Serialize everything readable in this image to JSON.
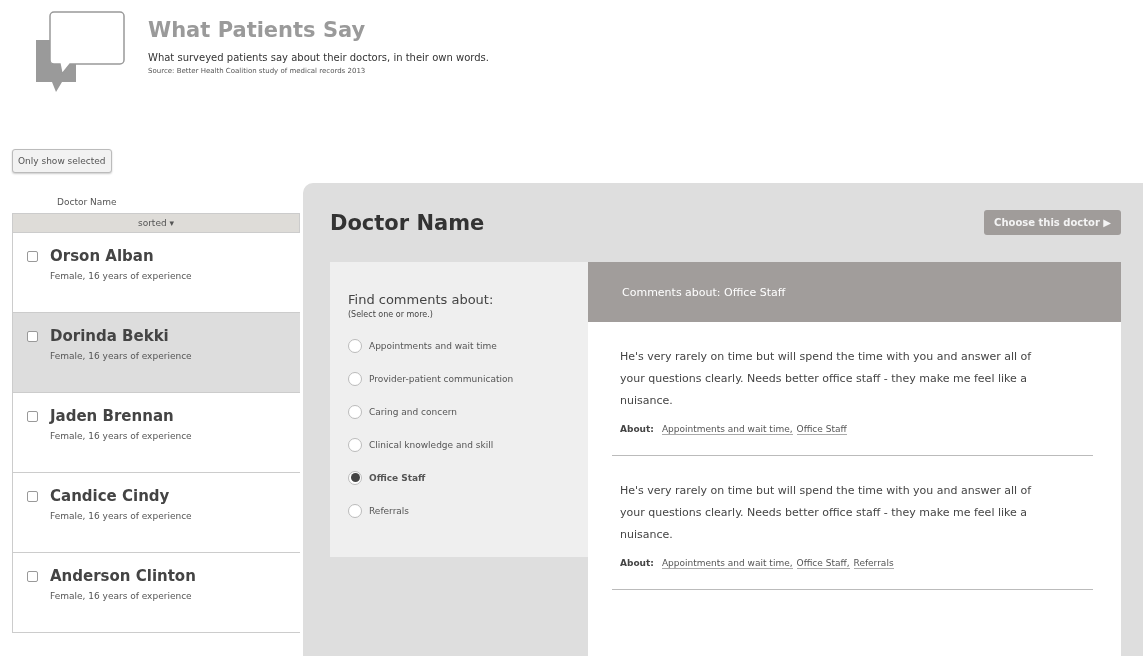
{
  "header": {
    "title": "What Patients Say",
    "subtitle": "What surveyed patients say about their doctors, in their own words.",
    "source": "Source: Better Health Coalition study of medical records 2013"
  },
  "filter_button": "Only show selected",
  "doctor_list": {
    "column": "Doctor Name",
    "sort_label": "sorted ▾",
    "doctors": [
      {
        "name": "Orson Alban",
        "details": "Female, 16 years of experience",
        "checked": false,
        "selected": false
      },
      {
        "name": "Dorinda Bekki",
        "details": "Female, 16 years of experience",
        "checked": false,
        "selected": true
      },
      {
        "name": "Jaden Brennan",
        "details": "Female, 16 years of experience",
        "checked": false,
        "selected": false
      },
      {
        "name": "Candice Cindy",
        "details": "Female, 16 years of experience",
        "checked": false,
        "selected": false
      },
      {
        "name": "Anderson Clinton",
        "details": "Female, 16 years of experience",
        "checked": false,
        "selected": false
      }
    ]
  },
  "detail": {
    "title": "Doctor Name",
    "choose_button": "Choose this doctor ▶",
    "filter": {
      "heading": "Find comments about:",
      "hint": "(Select one or more.)",
      "options": [
        {
          "label": "Appointments and wait time",
          "selected": false
        },
        {
          "label": "Provider-patient communication",
          "selected": false
        },
        {
          "label": "Caring and concern",
          "selected": false
        },
        {
          "label": "Clinical knowledge and skill",
          "selected": false
        },
        {
          "label": "Office Staff",
          "selected": true
        },
        {
          "label": "Referrals",
          "selected": false
        }
      ]
    },
    "comments": {
      "heading": "Comments about: Office Staff",
      "items": [
        {
          "text": "He's very rarely on time but will spend the time with you and answer all of your questions clearly. Needs better office staff - they make me feel like a nuisance.",
          "about_label": "About:",
          "tags": [
            "Appointments and wait time,",
            "Office Staff"
          ]
        },
        {
          "text": "He's very rarely on time but will spend the time with you and answer all of your questions clearly. Needs better office staff - they make me feel like a nuisance.",
          "about_label": "About:",
          "tags": [
            "Appointments and wait time,",
            "Office Staff,",
            "Referrals"
          ]
        }
      ]
    }
  }
}
